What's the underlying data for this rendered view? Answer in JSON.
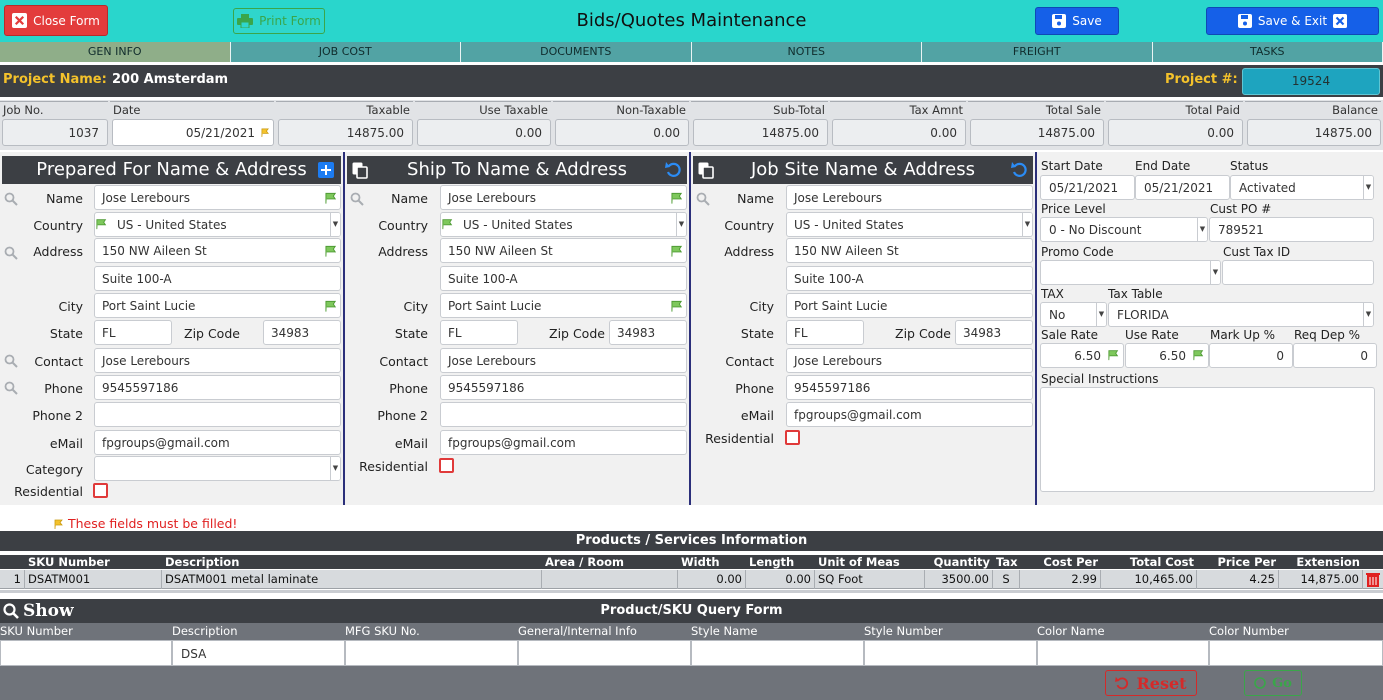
{
  "header": {
    "title": "Bids/Quotes Maintenance",
    "close_label": "Close Form",
    "print_label": "Print Form",
    "save_label": "Save",
    "save_exit_label": "Save & Exit"
  },
  "tabs": [
    "GEN INFO",
    "JOB COST",
    "DOCUMENTS",
    "NOTES",
    "FREIGHT",
    "TASKS"
  ],
  "project": {
    "name_label": "Project Name:",
    "name_value": "200 Amsterdam",
    "number_label": "Project #:",
    "number_value": "19524"
  },
  "totals": [
    {
      "label": "Job No.",
      "value": "1037"
    },
    {
      "label": "Date",
      "value": "05/21/2021"
    },
    {
      "label": "Taxable",
      "value": "14875.00"
    },
    {
      "label": "Use Taxable",
      "value": "0.00"
    },
    {
      "label": "Non-Taxable",
      "value": "0.00"
    },
    {
      "label": "Sub-Total",
      "value": "14875.00"
    },
    {
      "label": "Tax Amnt",
      "value": "0.00"
    },
    {
      "label": "Total Sale",
      "value": "14875.00"
    },
    {
      "label": "Total Paid",
      "value": "0.00"
    },
    {
      "label": "Balance",
      "value": "14875.00"
    }
  ],
  "labels": {
    "name": "Name",
    "country": "Country",
    "address": "Address",
    "city": "City",
    "state": "State",
    "zip": "Zip Code",
    "contact": "Contact",
    "phone": "Phone",
    "phone2": "Phone 2",
    "email": "eMail",
    "category": "Category",
    "residential": "Residential"
  },
  "prepared_for": {
    "title": "Prepared For Name & Address",
    "name": "Jose Lerebours",
    "country": "US - United States",
    "address1": "150 NW Aileen St",
    "address2": "Suite 100-A",
    "city": "Port Saint Lucie",
    "state": "FL",
    "zip": "34983",
    "contact": "Jose Lerebours",
    "phone": "9545597186",
    "phone2": "",
    "email": "fpgroups@gmail.com",
    "category": ""
  },
  "ship_to": {
    "title": "Ship To Name & Address",
    "name": "Jose Lerebours",
    "country": "US - United States",
    "address1": "150 NW Aileen St",
    "address2": "Suite 100-A",
    "city": "Port Saint Lucie",
    "state": "FL",
    "zip": "34983",
    "contact": "Jose Lerebours",
    "phone": "9545597186",
    "phone2": "",
    "email": "fpgroups@gmail.com"
  },
  "job_site": {
    "title": "Job Site Name & Address",
    "name": "Jose Lerebours",
    "country": "US - United States",
    "address1": "150 NW Aileen St",
    "address2": "Suite 100-A",
    "city": "Port Saint Lucie",
    "state": "FL",
    "zip": "34983",
    "contact": "Jose Lerebours",
    "phone": "9545597186",
    "email": "fpgroups@gmail.com"
  },
  "right": {
    "start_date_label": "Start Date",
    "start_date": "05/21/2021",
    "end_date_label": "End Date",
    "end_date": "05/21/2021",
    "status_label": "Status",
    "status": "Activated",
    "price_level_label": "Price Level",
    "price_level": "0 - No Discount",
    "cust_po_label": "Cust PO #",
    "cust_po": "789521",
    "promo_label": "Promo Code",
    "promo": "",
    "cust_tax_label": "Cust Tax ID",
    "cust_tax": "",
    "tax_label": "TAX",
    "tax": "No",
    "tax_table_label": "Tax Table",
    "tax_table": "FLORIDA",
    "sale_rate_label": "Sale Rate",
    "sale_rate": "6.50",
    "use_rate_label": "Use Rate",
    "use_rate": "6.50",
    "markup_label": "Mark Up %",
    "markup": "0",
    "req_dep_label": "Req Dep %",
    "req_dep": "0",
    "special_label": "Special Instructions",
    "special": ""
  },
  "required_note": "These fields must be filled!",
  "products": {
    "title": "Products / Services Information",
    "columns": [
      "SKU Number",
      "Description",
      "Area / Room",
      "Width",
      "Length",
      "Unit of Meas",
      "Quantity",
      "Tax",
      "Cost Per",
      "Total Cost",
      "Price Per",
      "Extension"
    ],
    "rows": [
      {
        "line": "1",
        "sku": "DSATM001",
        "description": "DSATM001 metal laminate",
        "area": "",
        "width": "0.00",
        "length": "0.00",
        "unit": "SQ Foot",
        "quantity": "3500.00",
        "tax": "S",
        "cost_per": "2.99",
        "total_cost": "10,465.00",
        "price_per": "4.25",
        "extension": "14,875.00"
      }
    ]
  },
  "query": {
    "show_label": "Show",
    "title": "Product/SKU Query Form",
    "columns": [
      "SKU Number",
      "Description",
      "MFG SKU No.",
      "General/Internal Info",
      "Style Name",
      "Style Number",
      "Color Name",
      "Color Number"
    ],
    "values": [
      "",
      "DSA",
      "",
      "",
      "",
      "",
      "",
      ""
    ],
    "reset_label": "Reset",
    "go_label": "Go"
  },
  "colors": {
    "accent": "#29d6cc",
    "dark": "#3c3f44",
    "red": "#e33c3c",
    "blue": "#1560e8",
    "yellow": "#f4c22b"
  }
}
